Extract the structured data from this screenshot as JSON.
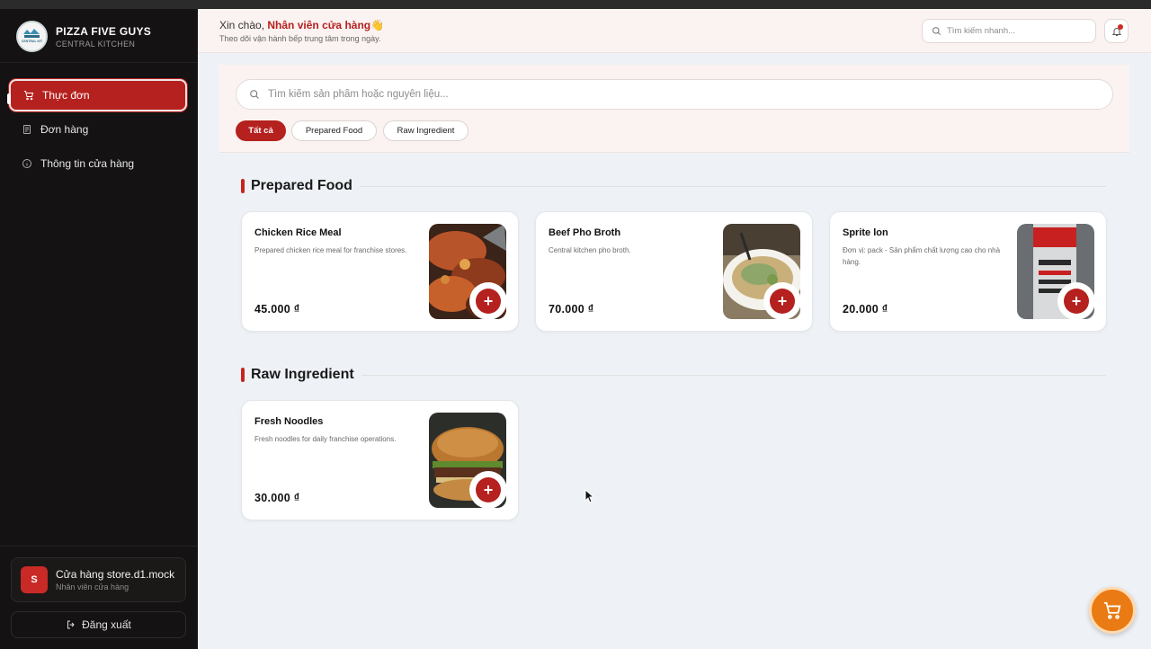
{
  "sidebar": {
    "brand_name": "PIZZA FIVE GUYS",
    "brand_sub": "CENTRAL KITCHEN",
    "logo_text": "CENTRAL KIT",
    "nav": [
      {
        "label": "Thực đơn",
        "icon": "cart-icon",
        "active": true
      },
      {
        "label": "Đơn hàng",
        "icon": "document-icon",
        "active": false
      },
      {
        "label": "Thông tin cửa hàng",
        "icon": "info-icon",
        "active": false
      }
    ],
    "store": {
      "avatar": "S",
      "name": "Cửa hàng store.d1.mock",
      "role": "Nhân viên cửa hàng"
    },
    "logout_label": "Đăng xuất"
  },
  "header": {
    "greet_prefix": "Xin chào,",
    "greet_name": "Nhân viên cửa hàng",
    "greet_emoji": "👋",
    "subtitle": "Theo dõi vận hành bếp trung tâm trong ngày.",
    "quick_search_placeholder": "Tìm kiếm nhanh..."
  },
  "filters": {
    "search_placeholder": "Tìm kiếm sản phẩm hoặc nguyên liệu...",
    "chips": [
      "Tất cả",
      "Prepared Food",
      "Raw Ingredient"
    ],
    "active_chip": "Tất cả"
  },
  "sections": [
    {
      "title": "Prepared Food",
      "items": [
        {
          "name": "Chicken Rice Meal",
          "desc": "Prepared chicken rice meal for franchise stores.",
          "price": "45.000 ₫",
          "image": "chicken-rice-photo"
        },
        {
          "name": "Beef Pho Broth",
          "desc": "Central kitchen pho broth.",
          "price": "70.000 ₫",
          "image": "pho-bowl-photo"
        },
        {
          "name": "Sprite lon",
          "desc": "Đơn vị: pack - Sản phẩm chất lượng cao cho nhà hàng.",
          "price": "20.000 ₫",
          "image": "cola-can-photo"
        }
      ]
    },
    {
      "title": "Raw Ingredient",
      "items": [
        {
          "name": "Fresh Noodles",
          "desc": "Fresh noodles for daily franchise operations.",
          "price": "30.000 ₫",
          "image": "burger-photo"
        }
      ]
    }
  ],
  "colors": {
    "accent": "#b5211e",
    "sidebar_bg": "#141212",
    "fab": "#ea7a13"
  }
}
